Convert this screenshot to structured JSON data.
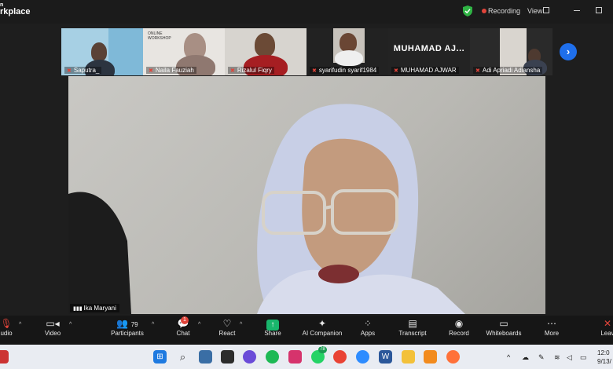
{
  "titlebar": {
    "app_title_line1": "n",
    "app_title_line2": "rkplace",
    "recording_label": "Recording",
    "view_label": "View"
  },
  "thumbnails": [
    {
      "name": "Saputra_"
    },
    {
      "name": "Naila Fauziah"
    },
    {
      "name": "Rizalul Fiqry"
    },
    {
      "name": "syarifudin syarif1984"
    },
    {
      "name": "MUHAMAD AJWAR",
      "display_text": "MUHAMAD AJ..."
    },
    {
      "name": "Adi Apriadi Adiansha"
    }
  ],
  "tile2_screen_text": "ONLINE\nWORKSHOP",
  "main_video": {
    "participant_name": "Ika Maryani"
  },
  "toolbar": {
    "items": [
      {
        "label": "udio",
        "icon": "microphone-muted-icon"
      },
      {
        "label": "Video",
        "icon": "video-camera-icon"
      },
      {
        "label": "Participants",
        "icon": "participants-icon",
        "count": "79"
      },
      {
        "label": "Chat",
        "icon": "chat-icon",
        "badge": "1"
      },
      {
        "label": "React",
        "icon": "heart-icon"
      },
      {
        "label": "Share",
        "icon": "share-screen-icon"
      },
      {
        "label": "AI Companion",
        "icon": "sparkle-icon"
      },
      {
        "label": "Apps",
        "icon": "apps-icon"
      },
      {
        "label": "Transcript",
        "icon": "transcript-icon"
      },
      {
        "label": "Record",
        "icon": "record-icon"
      },
      {
        "label": "Whiteboards",
        "icon": "whiteboard-icon"
      },
      {
        "label": "More",
        "icon": "more-icon"
      },
      {
        "label": "Leav",
        "icon": "leave-icon"
      }
    ]
  },
  "taskbar": {
    "whatsapp_badge": "78",
    "clock_time": "12:0",
    "clock_date": "9/13/"
  },
  "colors": {
    "accent_blue": "#1f6feb",
    "recording_red": "#e0443a",
    "share_green": "#19b66c",
    "toolbar_bg": "#161616"
  }
}
